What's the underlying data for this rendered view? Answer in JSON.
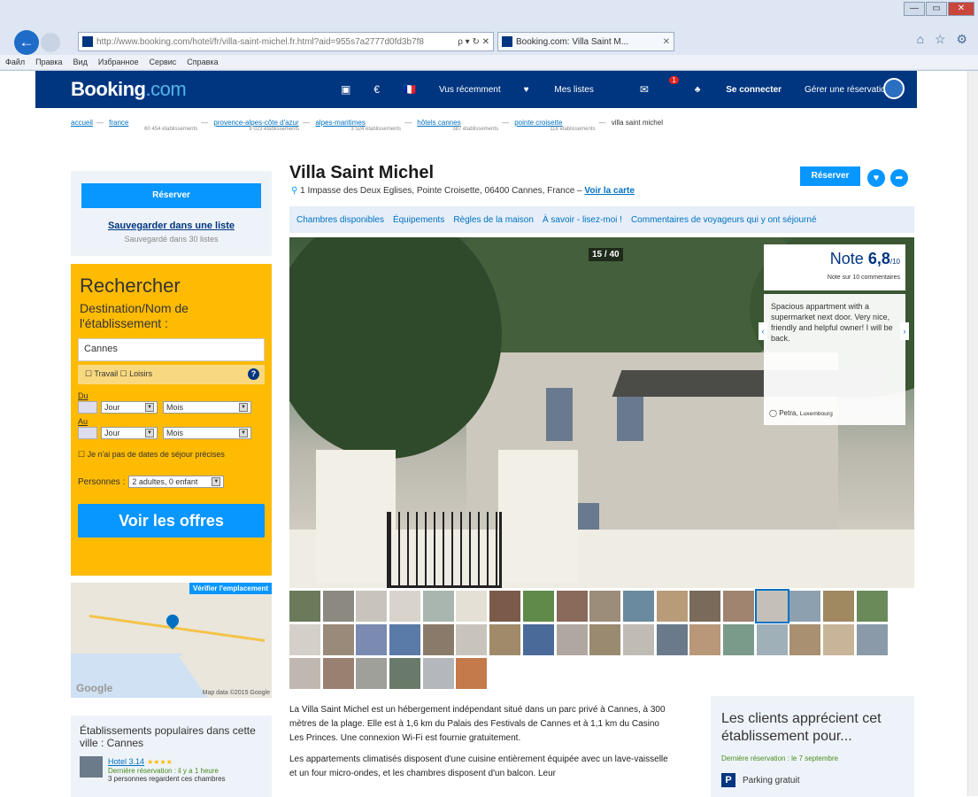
{
  "browser": {
    "url": "http://www.booking.com/hotel/fr/villa-saint-michel.fr.html?aid=955s7a2777d0fd3b7f8",
    "addr_controls": "ρ ▾ ↻ ✕",
    "tab_title": "Booking.com: Villa Saint M...",
    "tab_close": "✕",
    "right_icons": "⌂ ☆ ⚙",
    "menu": [
      "Файл",
      "Правка",
      "Вид",
      "Избранное",
      "Сервис",
      "Справка"
    ],
    "win_min": "—",
    "win_max": "▭",
    "win_close": "✕",
    "back": "←"
  },
  "header": {
    "logo_main": "Booking",
    "logo_dot": ".com",
    "flag": "🇫🇷",
    "euro": "€",
    "recent": "Vus récemment",
    "lists": "Mes listes",
    "mail_badge": "1",
    "login": "Se connecter",
    "manage": "Gérer une réservation",
    "heart": "♥",
    "mail": "✉",
    "book": "▣",
    "user": "♣"
  },
  "breadcrumbs": [
    {
      "label": "accueil",
      "count": ""
    },
    {
      "label": "france",
      "count": "60 454 établissements"
    },
    {
      "label": "provence-alpes-côte d'azur",
      "count": "9 023 établissements"
    },
    {
      "label": "alpes-maritimes",
      "count": "3 524 établissements"
    },
    {
      "label": "hôtels cannes",
      "count": "387 établissements"
    },
    {
      "label": "pointe croisette",
      "count": "118 établissements"
    }
  ],
  "breadcrumb_current": "villa saint michel",
  "sidebar": {
    "reserve": "Réserver",
    "save_link": "Sauvegarder dans une liste",
    "saved_count": "Sauvegardé dans 30 listes"
  },
  "search": {
    "title": "Rechercher",
    "dest_label": "Destination/Nom de l'établissement :",
    "dest_value": "Cannes",
    "travel": "☐ Travail",
    "leisure": "☐ Loisirs",
    "help": "?",
    "checkin_label": "Du",
    "checkout_label": "Au",
    "day": "Jour",
    "month": "Mois",
    "no_dates": "☐ Je n'ai pas de dates de séjour précises",
    "persons_label": "Personnes :",
    "persons_value": "2 adultes, 0 enfant",
    "submit": "Voir les offres"
  },
  "map": {
    "verify": "Vérifier l'emplacement",
    "google": "Google",
    "map_data": "Map data ©2015 Google"
  },
  "popular": {
    "title": "Établissements populaires dans cette ville : Cannes",
    "hotel": "Hotel 3.14",
    "stars": "★★★★",
    "last": "Dernière réservation : il y a 1 heure",
    "viewers": "3 personnes regardent ces chambres"
  },
  "property": {
    "name": "Villa Saint Michel",
    "address": "1 Impasse des Deux Eglises, Pointe Croisette, 06400 Cannes, France –",
    "map_link": "Voir la carte",
    "reserve": "Réserver",
    "heart": "♥",
    "share": "➦",
    "pin": "⚲"
  },
  "tabs": [
    "Chambres disponibles",
    "Équipements",
    "Règles de la maison",
    "À savoir - lisez-moi !",
    "Commentaires de voyageurs qui y ont séjourné"
  ],
  "gallery": {
    "counter": "15 / 40",
    "score_label": "Note",
    "score": "6,8",
    "score_max": "/10",
    "score_count": "Note sur 10 commentaires",
    "review": "Spacious appartment with a supermarket next door. Very nice, friendly and helpful owner! I will be back.",
    "reviewer": "Petra,",
    "reviewer_country": "Luxembourg",
    "prev": "‹",
    "next": "›"
  },
  "thumb_colors": [
    "#6b7a5a",
    "#8c8a80",
    "#c9c4bb",
    "#d8d4cc",
    "#a9b6b0",
    "#e4e0d6",
    "#7b5a4a",
    "#5f8a4a",
    "#8a6a5a",
    "#9c8c7a",
    "#6a8aa0",
    "#b89c7a",
    "#7a6a5a",
    "#a08470",
    "#c4c0b8",
    "#8ca0b0",
    "#a08860",
    "#6a8a5a",
    "#d4d0c8",
    "#9a8a7a",
    "#7a8ab0",
    "#5a7aa8",
    "#8a7a6a",
    "#c8c4bc",
    "#a08a6a",
    "#4a6a9a",
    "#b0a8a0",
    "#9a8a70",
    "#c0bcb4",
    "#6a7a8a",
    "#b89878",
    "#7a9a8a",
    "#a0b0b8",
    "#a89070",
    "#c8b498",
    "#8a9aa8",
    "#c0b8b0",
    "#9a8070",
    "#a0a09a",
    "#6a7a6a",
    "#b4b8bc",
    "#c47a4a"
  ],
  "description": {
    "p1": "La Villa Saint Michel est un hébergement indépendant situé dans un parc privé à Cannes, à 300 mètres de la plage. Elle est à 1,6 km du Palais des Festivals de Cannes et à 1,1 km du Casino Les Princes. Une connexion Wi-Fi est fournie gratuitement.",
    "p2": "Les appartements climatisés disposent d'une cuisine entièrement équipée avec un lave-vaisselle et un four micro-ondes, et les chambres disposent d'un balcon. Leur"
  },
  "clients": {
    "title": "Les clients apprécient cet établissement pour...",
    "last": "Dernière réservation : le 7 septembre",
    "parking_icon": "P",
    "parking": "Parking gratuit"
  }
}
